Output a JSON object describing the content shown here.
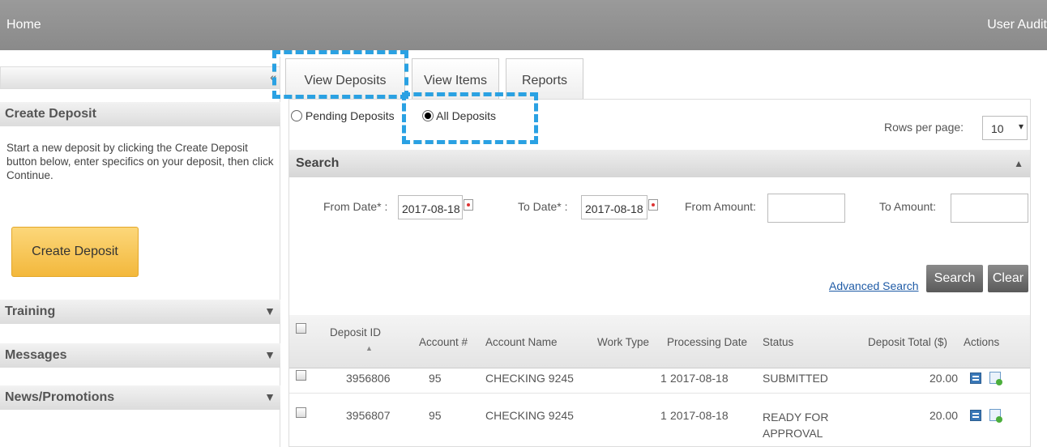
{
  "topbar": {
    "home": "Home",
    "user": "User Audit"
  },
  "left": {
    "collapse_icon": "«",
    "create_heading": "Create Deposit",
    "create_desc": "Start a new deposit by clicking the Create Deposit button below, enter specifics on your deposit, then click Continue.",
    "create_button": "Create Deposit",
    "sections": [
      {
        "label": "Training",
        "icon": "▼"
      },
      {
        "label": "Messages",
        "icon": "▼"
      },
      {
        "label": "News/Promotions",
        "icon": "▼"
      }
    ]
  },
  "tabs": [
    {
      "label": "View Deposits"
    },
    {
      "label": "View Items"
    },
    {
      "label": "Reports"
    }
  ],
  "filters": {
    "pending": "Pending Deposits",
    "all": "All Deposits",
    "selected": "All Deposits"
  },
  "rows_per_page": {
    "label": "Rows per page:",
    "value": "10",
    "caret": "▾"
  },
  "search": {
    "heading": "Search",
    "toggle_icon": "▲",
    "from_date_label": "From Date* :",
    "from_date": "2017-08-18",
    "to_date_label": "To Date* :",
    "to_date": "2017-08-18",
    "from_amount_label": "From Amount:",
    "to_amount_label": "To Amount:",
    "advanced": "Advanced Search",
    "search_button": "Search",
    "clear_button": "Clear"
  },
  "table": {
    "headers": {
      "deposit_id": "Deposit ID",
      "sort_icon": "▲",
      "account": "Account #",
      "account_name": "Account Name",
      "work_type": "Work Type",
      "processing_date": "Processing Date",
      "status": "Status",
      "deposit_total": "Deposit Total ($)",
      "actions": "Actions"
    },
    "rows": [
      {
        "deposit_id": "3956806",
        "account": "95",
        "account_name": "CHECKING 9245",
        "work_type": "1",
        "processing_date": "2017-08-18",
        "status": "SUBMITTED",
        "total": "20.00"
      },
      {
        "deposit_id": "3956807",
        "account": "95",
        "account_name": "CHECKING 9245",
        "work_type": "1",
        "processing_date": "2017-08-18",
        "status": "READY FOR APPROVAL",
        "total": "20.00"
      }
    ]
  }
}
